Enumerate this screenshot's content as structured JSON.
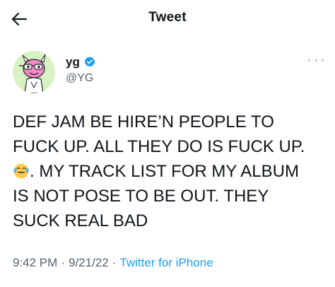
{
  "header": {
    "title": "Tweet",
    "back_icon": "arrow-left-icon"
  },
  "author": {
    "display_name": "yg",
    "handle": "@YG",
    "verified": true,
    "verified_color": "#1d9bf0",
    "avatar_icon": "cartoon-avatar"
  },
  "tweet": {
    "lines": [
      "DEF JAM BE HIRE’N PEOPLE TO",
      "FUCK UP. ALL THEY DO IS FUCK UP.",
      ". MY TRACK LIST FOR MY ALBUM",
      "IS NOT POSE TO BE OUT. THEY",
      "SUCK REAL BAD"
    ],
    "emoji": "face-with-tears-of-joy-icon"
  },
  "meta": {
    "time": "9:42 PM",
    "separator": "·",
    "date": "9/21/22",
    "source": "Twitter for iPhone",
    "link_color": "#1d9bf0"
  }
}
